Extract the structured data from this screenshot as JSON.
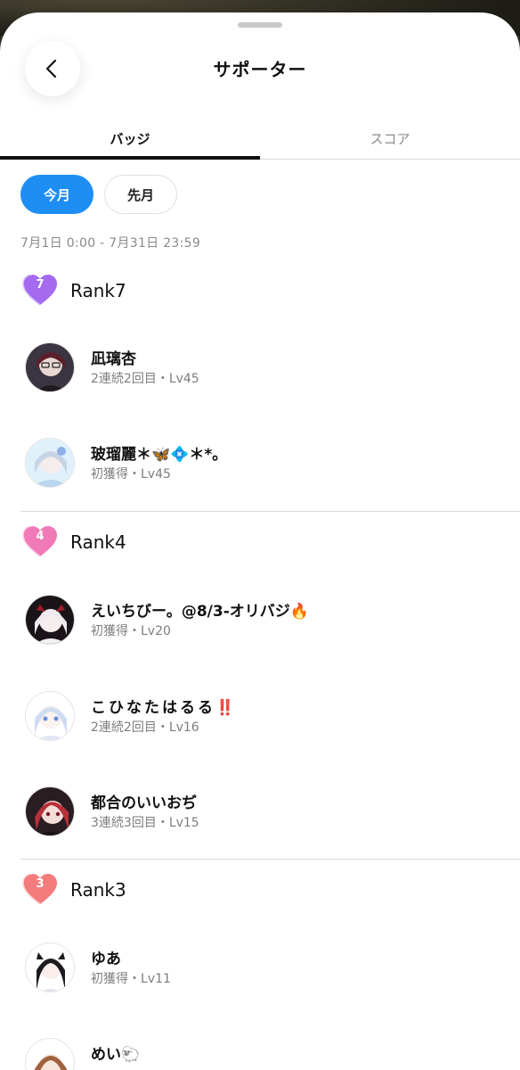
{
  "header": {
    "title": "サポーター"
  },
  "tabs": [
    {
      "label": "バッジ",
      "active": true
    },
    {
      "label": "スコア",
      "active": false
    }
  ],
  "filters": [
    {
      "label": "今月",
      "active": true
    },
    {
      "label": "先月",
      "active": false
    }
  ],
  "date_range": "7月1日 0:00 - 7月31日 23:59",
  "ranks": [
    {
      "label": "Rank7",
      "number": "7",
      "color": "#a46af0"
    },
    {
      "label": "Rank4",
      "number": "4",
      "color": "#f07ab8"
    },
    {
      "label": "Rank3",
      "number": "3",
      "color": "#f47c7c"
    }
  ],
  "users": [
    {
      "name": "凪璃杏",
      "meta": "2連続2回目・Lv45"
    },
    {
      "name": "玻瑠麗＊🦋💠＊*。",
      "meta": "初獲得・Lv45"
    },
    {
      "name": "えいちびー。@8/3-オリバジ🔥",
      "meta": "初獲得・Lv20"
    },
    {
      "name": "こひなたはるる‼️",
      "meta": "2連続2回目・Lv16"
    },
    {
      "name": "都合のいいおぢ",
      "meta": "3連続3回目・Lv15"
    },
    {
      "name": "ゆあ",
      "meta": "初獲得・Lv11"
    },
    {
      "name": "めい🐑",
      "meta": ""
    }
  ]
}
